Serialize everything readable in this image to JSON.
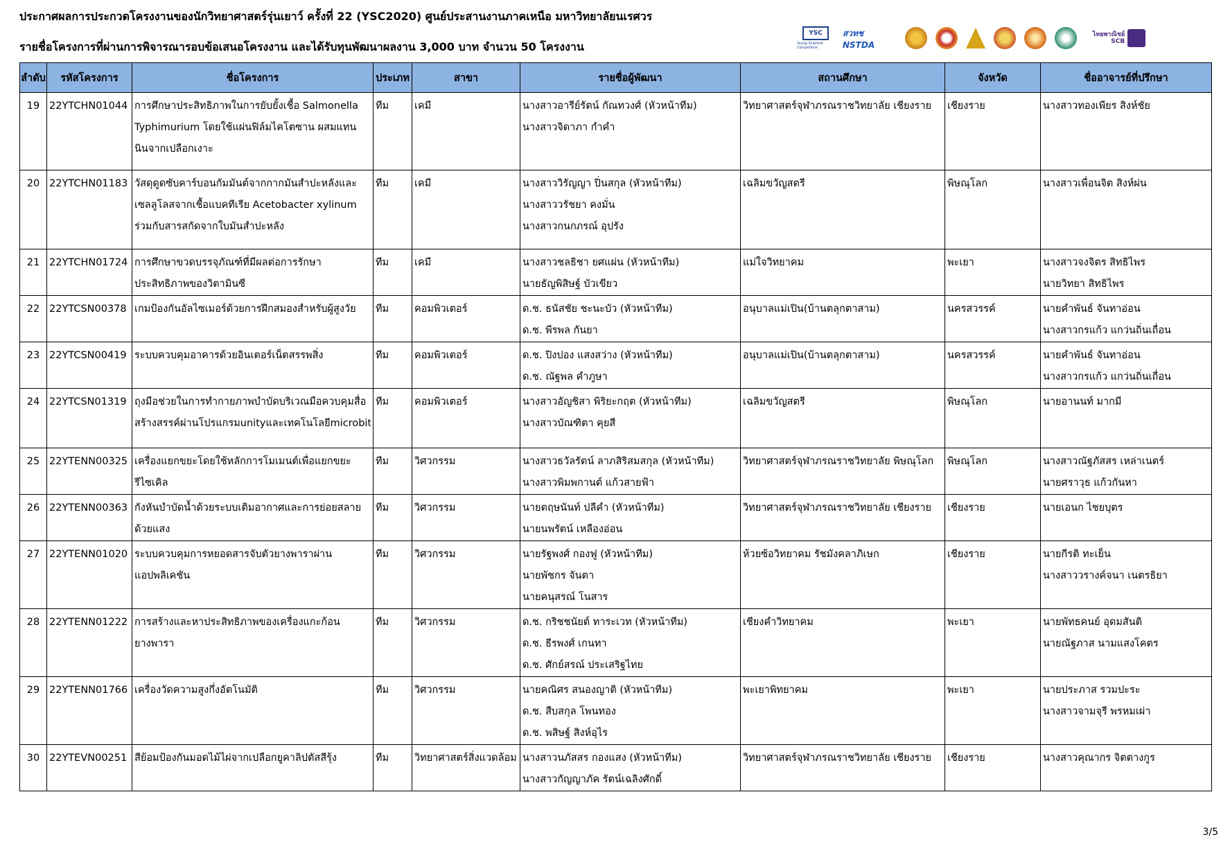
{
  "header": {
    "title": "ประกาศผลการประกวดโครงงานของนักวิทยาศาสตร์รุ่นเยาว์ ครั้งที่ 22 (YSC2020) ศูนย์ประสานงานภาคเหนือ มหาวิทยาลัยนเรศวร",
    "subtitle": "รายชื่อโครงการที่ผ่านการพิจารณารอบข้อเสนอโครงงาน และได้รับทุนพัฒนาผลงาน 3,000 บาท จำนวน 50 โครงงาน"
  },
  "logos": {
    "ysc": "YSC",
    "ysc_caption": "Young Scientist Competition",
    "nstda": "สวทช NSTDA",
    "scb_th": "ไทยพาณิชย์",
    "scb_en": "SCB"
  },
  "table": {
    "columns": [
      "ลำดับ",
      "รหัสโครงการ",
      "ชื่อโครงการ",
      "ประเภท",
      "สาขา",
      "รายชื่อผู้พัฒนา",
      "สถานศึกษา",
      "จังหวัด",
      "ชื่ออาจารย์ที่ปรึกษา"
    ],
    "rows": [
      {
        "no": "19",
        "code": "22YTCHN01044",
        "name": [
          "การศึกษาประสิทธิภาพในการยับยั้งเชื้อ Salmonella",
          "Typhimurium โดยใช้แผ่นฟิล์มไคโตซาน ผสมแทน",
          "นินจากเปลือกเงาะ"
        ],
        "type": "ทีม",
        "field": "เคมี",
        "members": [
          "นางสาวอารีย์รัตน์ กัณทวงศ์ (หัวหน้าทีม)",
          "นางสาวจิดาภา กำคำ"
        ],
        "school": "วิทยาศาสตร์จุฬาภรณราชวิทยาลัย เชียงราย",
        "province": "เชียงราย",
        "advisors": [
          "นางสาวทองเพียร สิงห์ชัย"
        ]
      },
      {
        "no": "20",
        "code": "22YTCHN01183",
        "name": [
          "วัสดุดูดซับคาร์บอนกัมมันต์จากกากมันสำปะหลังและ",
          "เซลลูโลสจากเชื้อแบคทีเรีย  Acetobacter xylinum",
          "ร่วมกับสารสกัดจากใบมันสำปะหลัง"
        ],
        "type": "ทีม",
        "field": "เคมี",
        "members": [
          "นางสาววิรัญญา ปิ่นสกุล (หัวหน้าทีม)",
          "นางสาววรัชยา คงมั่น",
          "นางสาวกนกภรณ์ อุปรัง"
        ],
        "school": "เฉลิมขวัญสตรี",
        "province": "พิษณุโลก",
        "advisors": [
          "นางสาวเพื่อนจิต สิงห์ผ่น"
        ]
      },
      {
        "no": "21",
        "code": "22YTCHN01724",
        "name": [
          "การศึกษาขวดบรรจุภัณฑ์ที่มีผลต่อการรักษา",
          "ประสิทธิภาพของวิตามินซี"
        ],
        "type": "ทีม",
        "field": "เคมี",
        "members": [
          "นางสาวชลธิชา ยศแผ่น (หัวหน้าทีม)",
          "นายธัญพิสิษฐ์ บัวเขียว"
        ],
        "school": "แม่ใจวิทยาคม",
        "province": "พะเยา",
        "advisors": [
          "นางสาวจงจิตร สิทธิไพร",
          "นายวิทยา สิทธิไพร"
        ]
      },
      {
        "no": "22",
        "code": "22YTCSN00378",
        "name": [
          "เกมป้องกันอัลไซเมอร์ด้วยการฝึกสมองสำหรับผู้สูงวัย"
        ],
        "type": "ทีม",
        "field": "คอมพิวเตอร์",
        "members": [
          "ด.ช. ธนัสชัย ชะนะบัว (หัวหน้าทีม)",
          "ด.ช. พีรพล กันยา"
        ],
        "school": "อนุบาลแม่เปิน(บ้านตลุกตาสาม)",
        "province": "นครสวรรค์",
        "advisors": [
          "นายคำพันธ์ จันทาอ่อน",
          "นางสาวกรแก้ว แกว่นถิ่นเถื่อน"
        ]
      },
      {
        "no": "23",
        "code": "22YTCSN00419",
        "name": [
          "ระบบควบคุมอาคารด้วยอินเตอร์เน็ตสรรพสิ่ง"
        ],
        "type": "ทีม",
        "field": "คอมพิวเตอร์",
        "members": [
          "ด.ช. ปิงปอง แสงสว่าง (หัวหน้าทีม)",
          "ด.ช. ณัฐพล คำภูษา"
        ],
        "school": "อนุบาลแม่เปิน(บ้านตลุกตาสาม)",
        "province": "นครสวรรค์",
        "advisors": [
          "นายคำพันธ์ จันทาอ่อน",
          "นางสาวกรแก้ว แกว่นถิ่นเถื่อน"
        ]
      },
      {
        "no": "24",
        "code": "22YTCSN01319",
        "name": [
          "ถุงมือช่วยในการทำกายภาพบำบัดบริเวณมือควบคุมสื่อ",
          "สร้างสรรค์ผ่านโปรแกรมunityและเทคโนโลยีmicrobit"
        ],
        "type": "ทีม",
        "field": "คอมพิวเตอร์",
        "members": [
          "นางสาวอัญชิสา พิริยะกฤต (หัวหน้าทีม)",
          "นางสาวบัณฑิตา คุยสี"
        ],
        "school": "เฉลิมขวัญสตรี",
        "province": "พิษณุโลก",
        "advisors": [
          "นายอานนท์ มากมี"
        ]
      },
      {
        "no": "25",
        "code": "22YTENN00325",
        "name": [
          "เครื่องแยกขยะโดยใช้หลักการโมเมนต์เพื่อแยกขยะ",
          "รีไซเคิล"
        ],
        "type": "ทีม",
        "field": "วิศวกรรม",
        "members": [
          "นางสาวธวัลรัตน์ ลาภสิริสมสกุล (หัวหน้าทีม)",
          "นางสาวพิมพกานต์ แก้วสายฟ้า"
        ],
        "school": "วิทยาศาสตร์จุฬาภรณราชวิทยาลัย พิษณุโลก",
        "province": "พิษณุโลก",
        "advisors": [
          "นางสาวณัฐภัสสร เหล่าเนตร์",
          "นายศราวุธ แก้วกันหา"
        ]
      },
      {
        "no": "26",
        "code": "22YTENN00363",
        "name": [
          "กังหันบำบัดน้ำด้วยระบบเติมอากาศและการย่อยสลาย",
          "ด้วยแสง"
        ],
        "type": "ทีม",
        "field": "วิศวกรรม",
        "members": [
          "นายตฤษนันท์ ปลีคำ (หัวหน้าทีม)",
          "นายนพรัตน์ เหลืองอ่อน"
        ],
        "school": "วิทยาศาสตร์จุฬาภรณราชวิทยาลัย เชียงราย",
        "province": "เชียงราย",
        "advisors": [
          "นายเอนก ไชยบุตร"
        ]
      },
      {
        "no": "27",
        "code": "22YTENN01020",
        "name": [
          "ระบบควบคุมการหยอดสารจับตัวยางพาราผ่าน",
          "แอปพลิเคชัน"
        ],
        "type": "ทีม",
        "field": "วิศวกรรม",
        "members": [
          "นายรัฐพงศ์ กองฟู (หัวหน้าทีม)",
          "นายพัชกร จันตา",
          "นายคนุสรณ์ โนสาร"
        ],
        "school": "ห้วยซ้อวิทยาคม รัชมังคลาภิเษก",
        "province": "เชียงราย",
        "advisors": [
          "นายกีรติ ทะเย็น",
          "นางสาววรางค์จนา เนตรธิยา"
        ]
      },
      {
        "no": "28",
        "code": "22YTENN01222",
        "name": [
          "การสร้างและหาประสิทธิภาพของเครื่องแกะก้อน",
          "ยางพารา"
        ],
        "type": "ทีม",
        "field": "วิศวกรรม",
        "members": [
          "ด.ช. กริชชนัยต์ ทาระเวท (หัวหน้าทีม)",
          "ด.ช. ธีรพงศ์ เกนทา",
          "ด.ช. ศักย์สรณ์ ประเสริฐไทย"
        ],
        "school": "เชียงคำวิทยาคม",
        "province": "พะเยา",
        "advisors": [
          "นายพัทธคนย์ อุดมสันติ",
          "นายณัฐภาส นามแสงโคตร"
        ]
      },
      {
        "no": "29",
        "code": "22YTENN01766",
        "name": [
          "เครื่องวัดความสูงกึ่งอัตโนมัติ"
        ],
        "type": "ทีม",
        "field": "วิศวกรรม",
        "members": [
          "นายคณิศร สนองญาติ (หัวหน้าทีม)",
          "ด.ช. สืบสกุล โพนทอง",
          "ด.ช. พสิษฐ์ สิงห์อุไร"
        ],
        "school": "พะเยาพิทยาคม",
        "province": "พะเยา",
        "advisors": [
          "นายประภาส รวมปะระ",
          "นางสาวจามจุรี พรหมเผ่า"
        ]
      },
      {
        "no": "30",
        "code": "22YTEVN00251",
        "name": [
          "สีย้อมป้องกันมอดไม้ไผ่จากเปลือกยูคาลิปตัสสีรุ้ง"
        ],
        "type": "ทีม",
        "field": "วิทยาศาสตร์สิ่งแวดล้อม",
        "members": [
          "นางสาวนภัสสร กองแสง (หัวหน้าทีม)",
          "นางสาวกัญญาภัค รัตน์เฉลิงศักดิ์"
        ],
        "school": "วิทยาศาสตร์จุฬาภรณราชวิทยาลัย เชียงราย",
        "province": "เชียงราย",
        "advisors": [
          "นางสาวคุณากร จิตตางกูร"
        ]
      }
    ]
  },
  "footer": {
    "page": "3/5"
  }
}
